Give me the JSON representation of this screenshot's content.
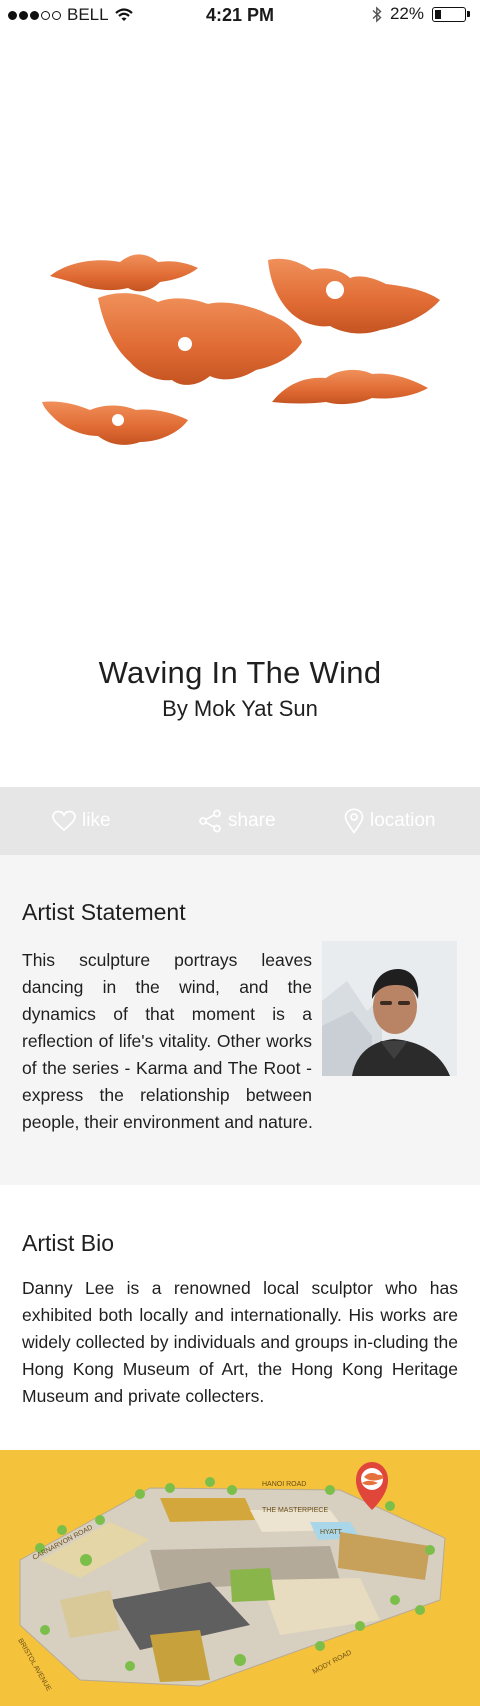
{
  "status_bar": {
    "carrier": "BELL",
    "time": "4:21 PM",
    "battery": "22%",
    "battery_level": 0.22,
    "signal_bars": 3,
    "signal_total": 5
  },
  "artwork": {
    "title": "Waving In The Wind",
    "byline": "By Mok Yat Sun",
    "sculpture_color": "#e5723c"
  },
  "actions": {
    "like_label": "like",
    "share_label": "share",
    "location_label": "location"
  },
  "statement": {
    "heading": "Artist Statement",
    "text": "This sculpture portrays leaves dancing in the wind, and the dynamics of that moment is a reflection of life's vitality. Other works of the series - Karma and The Root - express the relationship between people, their environment and nature."
  },
  "bio": {
    "heading": "Artist Bio",
    "text": "Danny Lee is a renowned local sculptor who has exhibited both locally and internationally. His works are widely collected by individuals and groups in-cluding the Hong Kong Museum of Art, the Hong Kong Heritage Museum and private collecters."
  },
  "map": {
    "labels": {
      "hanoi": "HANOI ROAD",
      "carnarvon": "CARNARVON ROAD",
      "bristol": "BRISTOL AVENUE",
      "mody": "MODY ROAD",
      "masterpiece": "THE MASTERPIECE",
      "hyatt": "HYATT"
    },
    "background_color": "#f5c23c",
    "pin_color": "#e0463a"
  },
  "icons": [
    "wifi-icon",
    "bluetooth-icon",
    "heart-icon",
    "share-icon",
    "location-pin-icon",
    "map-pin-icon"
  ]
}
